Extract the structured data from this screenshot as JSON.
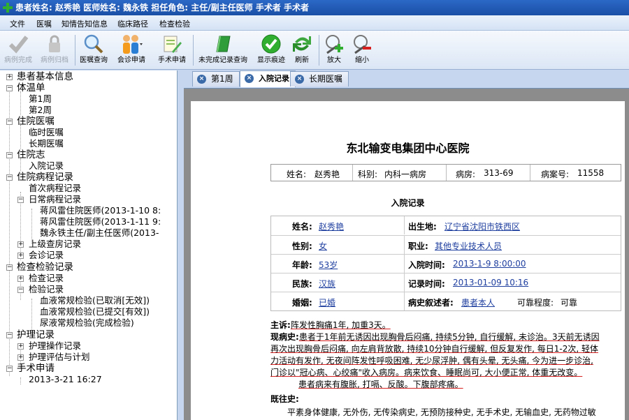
{
  "window": {
    "title": "患者姓名: 赵秀艳  医师姓名: 魏永铁  担任角色: 主任/副主任医师  手术者  手术者"
  },
  "menu": [
    "文件",
    "医嘱",
    "知情告知信息",
    "临床路径",
    "检查检验"
  ],
  "toolbar": {
    "items": [
      {
        "label": "病例完成",
        "icon": "check-gray-icon"
      },
      {
        "label": "病例归档",
        "icon": "lock-icon"
      },
      {
        "label": "医嘱查询",
        "icon": "magnifier-icon"
      },
      {
        "label": "会诊申请",
        "icon": "people-icon"
      },
      {
        "label": "手术申请",
        "icon": "form-pencil-icon"
      },
      {
        "label": "未完成记录查询",
        "icon": "green-book-icon"
      },
      {
        "label": "显示痕迹",
        "icon": "green-check-icon"
      },
      {
        "label": "刷新",
        "icon": "refresh-icon"
      },
      {
        "label": "放大",
        "icon": "zoom-in-icon"
      },
      {
        "label": "缩小",
        "icon": "zoom-out-icon"
      }
    ]
  },
  "tree": {
    "n0": "患者基本信息",
    "n1": "体温单",
    "n1a": "第1周",
    "n1b": "第2周",
    "n2": "住院医嘱",
    "n2a": "临时医嘱",
    "n2b": "长期医嘱",
    "n3": "住院志",
    "n3a": "入院记录",
    "n4": "住院病程记录",
    "n4a": "首次病程记录",
    "n4b": "日常病程记录",
    "n4b1": "蒋风雷住院医师(2013-1-10 8:",
    "n4b2": "蒋风雷住院医师(2013-1-11 9:",
    "n4b3": "魏永铁主任/副主任医师(2013-",
    "n4c": "上级查房记录",
    "n4d": "会诊记录",
    "n5": "检查检验记录",
    "n5a": "检查记录",
    "n5b": "检验记录",
    "n5b1": "血液常规检验(已取消[无效])",
    "n5b2": "血液常规检验(已提交[有效])",
    "n5b3": "尿液常规检验(完成检验)",
    "n6": "护理记录",
    "n6a": "护理操作记录",
    "n6b": "护理评估与计划",
    "n7": "手术申请",
    "n7a": "2013-3-21 16:27"
  },
  "tabs": [
    "第1周",
    "入院记录",
    "长期医嘱"
  ],
  "document": {
    "hospital": "东北输变电集团中心医院",
    "name_label": "姓名:",
    "name": "赵秀艳",
    "dept_label": "科别:",
    "dept": "内科一病房",
    "ward_label": "病房:",
    "ward": "313-69",
    "case_label": "病案号:",
    "case_no": "11558",
    "section_title": "入院记录",
    "grid": {
      "name_l": "姓名:",
      "name_v": "赵秀艳",
      "birth_l": "出生地:",
      "birth_v": "辽宁省沈阳市铁西区",
      "sex_l": "性别:",
      "sex_v": "女",
      "job_l": "职业:",
      "job_v": "其他专业技术人员",
      "age_l": "年龄:",
      "age_v": "53岁",
      "adm_l": "入院时间:",
      "adm_v": "2013-1-9 8:00:00",
      "eth_l": "民族:",
      "eth_v": "汉族",
      "rec_l": "记录时间:",
      "rec_v": "2013-01-09 10:16",
      "mar_l": "婚姻:",
      "mar_v": "已婚",
      "nar_l": "病史叙述者:",
      "nar_v": "患者本人",
      "rel_l": "可靠程度:",
      "rel_v": "可靠"
    },
    "complaint_label": "主诉:",
    "complaint": "阵发性胸痛1年, 加重3天。",
    "hpi_label": "现病史:",
    "hpi_lines": [
      "患者于1年前无诱因出现胸骨后闷痛, 持续5分钟, 自行缓解, 未诊治。3天前无诱因",
      "再次出现胸骨后闷痛, 向左肩背放散, 持续10分钟自行缓解, 但反复发作, 每日1-2次, 轻体",
      "力活动有发作, 无夜间阵发性呼吸困难, 无少尿浮肿, 偶有头晕, 无头痛, 今为进一步诊治,",
      "门诊以\"冠心病、心绞痛\"收入病房。病来饮食、睡眠尚可, 大小便正常, 体重无改变。",
      "患者病来有腹胀, 打嗝、反酸。下腹部疼痛。"
    ],
    "past_label": "既往史:",
    "past_line": "平素身体健康, 无外伤, 无传染病史, 无预防接种史, 无手术史, 无输血史, 无药物过敏"
  }
}
